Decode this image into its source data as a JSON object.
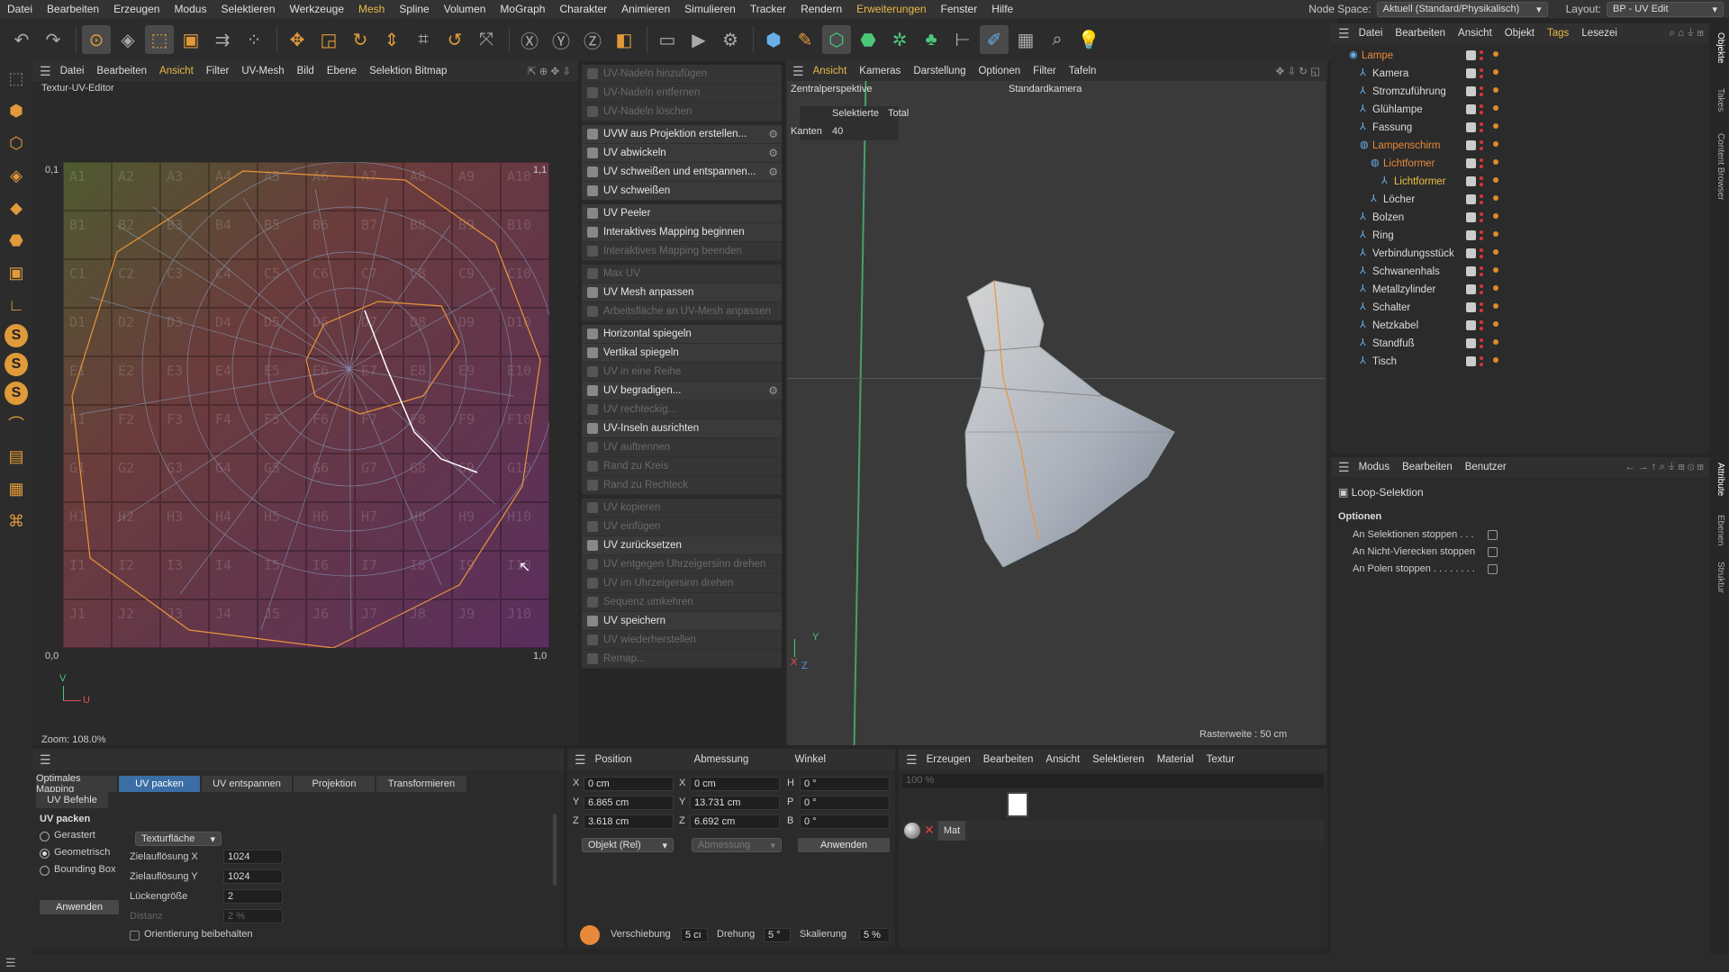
{
  "menubar": {
    "items": [
      "Datei",
      "Bearbeiten",
      "Erzeugen",
      "Modus",
      "Selektieren",
      "Werkzeuge",
      "Mesh",
      "Spline",
      "Volumen",
      "MoGraph",
      "Charakter",
      "Animieren",
      "Simulieren",
      "Tracker",
      "Rendern",
      "Erweiterungen",
      "Fenster",
      "Hilfe"
    ],
    "node_space_label": "Node Space:",
    "node_space_value": "Aktuell (Standard/Physikalisch)",
    "layout_label": "Layout:",
    "layout_value": "BP - UV Edit"
  },
  "uv_editor": {
    "menu": [
      "Datei",
      "Bearbeiten",
      "Ansicht",
      "Filter",
      "UV-Mesh",
      "Bild",
      "Ebene",
      "Selektion Bitmap"
    ],
    "title": "Textur-UV-Editor",
    "zoom": "Zoom: 108.0%",
    "corner_tl": "0,1",
    "corner_tr": "1,1",
    "corner_bl": "0,0",
    "corner_br": "1,0",
    "axis_v": "V",
    "axis_u": "U",
    "grid_rows": [
      "A",
      "B",
      "C",
      "D",
      "E",
      "F",
      "G",
      "H",
      "I",
      "J"
    ],
    "grid_cols": 10
  },
  "uv_commands": [
    {
      "label": "UV-Nadeln hinzufügen",
      "enabled": false
    },
    {
      "label": "UV-Nadeln entfernen",
      "enabled": false
    },
    {
      "label": "UV-Nadeln löschen",
      "enabled": false
    },
    {
      "label": "UVW aus Projektion erstellen...",
      "enabled": true,
      "gear": true,
      "gap": true
    },
    {
      "label": "UV abwickeln",
      "enabled": true,
      "gear": true
    },
    {
      "label": "UV schweißen und entspannen...",
      "enabled": true,
      "gear": true
    },
    {
      "label": "UV schweißen",
      "enabled": true
    },
    {
      "label": "UV Peeler",
      "enabled": true,
      "gap": true
    },
    {
      "label": "Interaktives Mapping beginnen",
      "enabled": true
    },
    {
      "label": "Interaktives Mapping beenden",
      "enabled": false
    },
    {
      "label": "Max UV",
      "enabled": false,
      "gap": true
    },
    {
      "label": "UV Mesh anpassen",
      "enabled": true
    },
    {
      "label": "Arbeitsfläche an UV-Mesh anpassen",
      "enabled": false
    },
    {
      "label": "Horizontal spiegeln",
      "enabled": true,
      "gap": true
    },
    {
      "label": "Vertikal spiegeln",
      "enabled": true
    },
    {
      "label": "UV in eine Reihe",
      "enabled": false
    },
    {
      "label": "UV begradigen...",
      "enabled": true,
      "gear": true
    },
    {
      "label": "UV rechteckig...",
      "enabled": false
    },
    {
      "label": "UV-Inseln ausrichten",
      "enabled": true
    },
    {
      "label": "UV auftrennen",
      "enabled": false
    },
    {
      "label": "Rand zu Kreis",
      "enabled": false
    },
    {
      "label": "Rand zu Rechteck",
      "enabled": false
    },
    {
      "label": "UV kopieren",
      "enabled": false,
      "gap": true
    },
    {
      "label": "UV einfügen",
      "enabled": false
    },
    {
      "label": "UV zurücksetzen",
      "enabled": true
    },
    {
      "label": "UV entgegen Uhrzeigersinn drehen",
      "enabled": false
    },
    {
      "label": "UV im Uhrzeigersinn drehen",
      "enabled": false
    },
    {
      "label": "Sequenz umkehren",
      "enabled": false
    },
    {
      "label": "UV speichern",
      "enabled": true
    },
    {
      "label": "UV wiederherstellen",
      "enabled": false
    },
    {
      "label": "Remap...",
      "enabled": false
    }
  ],
  "viewport": {
    "menu": [
      "Ansicht",
      "Kameras",
      "Darstellung",
      "Optionen",
      "Filter",
      "Tafeln"
    ],
    "perspective": "Zentralperspektive",
    "camera": "Standardkamera",
    "stats_selected": "Selektierte",
    "stats_total": "Total",
    "stats_row_label": "Kanten",
    "stats_row_value": "40",
    "grid_info": "Rasterweite : 50 cm",
    "axis_y": "Y",
    "axis_x": "X",
    "axis_z": "Z"
  },
  "objects": {
    "menu": [
      "Datei",
      "Bearbeiten",
      "Ansicht",
      "Objekt",
      "Tags",
      "Lesezei"
    ],
    "items": [
      {
        "name": "Lampe",
        "indent": 0,
        "color": "orange"
      },
      {
        "name": "Kamera",
        "indent": 1
      },
      {
        "name": "Stromzuführung",
        "indent": 1
      },
      {
        "name": "Glühlampe",
        "indent": 1
      },
      {
        "name": "Fassung",
        "indent": 1
      },
      {
        "name": "Lampenschirm",
        "indent": 1,
        "color": "orange"
      },
      {
        "name": "Lichtformer",
        "indent": 2,
        "color": "orange"
      },
      {
        "name": "Lichtformer",
        "indent": 3,
        "color": "yellow"
      },
      {
        "name": "Löcher",
        "indent": 2
      },
      {
        "name": "Bolzen",
        "indent": 1
      },
      {
        "name": "Ring",
        "indent": 1
      },
      {
        "name": "Verbindungsstück",
        "indent": 1
      },
      {
        "name": "Schwanenhals",
        "indent": 1
      },
      {
        "name": "Metallzylinder",
        "indent": 1
      },
      {
        "name": "Schalter",
        "indent": 1
      },
      {
        "name": "Netzkabel",
        "indent": 1
      },
      {
        "name": "Standfuß",
        "indent": 1
      },
      {
        "name": "Tisch",
        "indent": 1
      }
    ],
    "side_tabs": [
      "Objekte",
      "Takes",
      "Content Browser"
    ]
  },
  "attributes": {
    "menu": [
      "Modus",
      "Bearbeiten",
      "Benutzer"
    ],
    "title": "Loop-Selektion",
    "section": "Optionen",
    "options": [
      "An Selektionen stoppen . . .",
      "An Nicht-Vierecken stoppen",
      "An Polen stoppen . . . . . . . ."
    ],
    "side_tabs": [
      "Attribute",
      "Ebenen",
      "Struktur"
    ]
  },
  "uv_pack": {
    "tabs": [
      "Optimales Mapping",
      "UV packen",
      "UV entspannen",
      "Projektion",
      "Transformieren",
      "UV Befehle"
    ],
    "active_tab": "UV packen",
    "section": "UV packen",
    "radios": [
      "Gerastert",
      "Geometrisch",
      "Bounding Box"
    ],
    "selected_radio": "Geometrisch",
    "mode": "Texturfläche",
    "res_x_label": "Zielauflösung X",
    "res_x": "1024",
    "res_y_label": "Zielauflösung Y",
    "res_y": "1024",
    "gap_label": "Lückengröße",
    "gap": "2",
    "dist_label": "Distanz",
    "dist": "2 %",
    "apply": "Anwenden",
    "keep_orient": "Orientierung beibehalten"
  },
  "coords": {
    "headers": [
      "Position",
      "Abmessung",
      "Winkel"
    ],
    "rows": [
      {
        "axis": "X",
        "pos": "0 cm",
        "saxis": "X",
        "size": "0 cm",
        "raxis": "H",
        "rot": "0 °"
      },
      {
        "axis": "Y",
        "pos": "6.865 cm",
        "saxis": "Y",
        "size": "13.731 cm",
        "raxis": "P",
        "rot": "0 °"
      },
      {
        "axis": "Z",
        "pos": "3.618 cm",
        "saxis": "Z",
        "size": "6.692 cm",
        "raxis": "B",
        "rot": "0 °"
      }
    ],
    "mode": "Objekt (Rel)",
    "size_mode": "Abmessung",
    "apply": "Anwenden",
    "move_label": "Verschiebung",
    "move": "5 cı",
    "rot_label": "Drehung",
    "rot": "5 °",
    "scale_label": "Skalierung",
    "scale": "5 %"
  },
  "materials": {
    "menu": [
      "Erzeugen",
      "Bearbeiten",
      "Ansicht",
      "Selektieren",
      "Material",
      "Textur"
    ],
    "zoom": "100 %",
    "mat_name": "Mat"
  }
}
